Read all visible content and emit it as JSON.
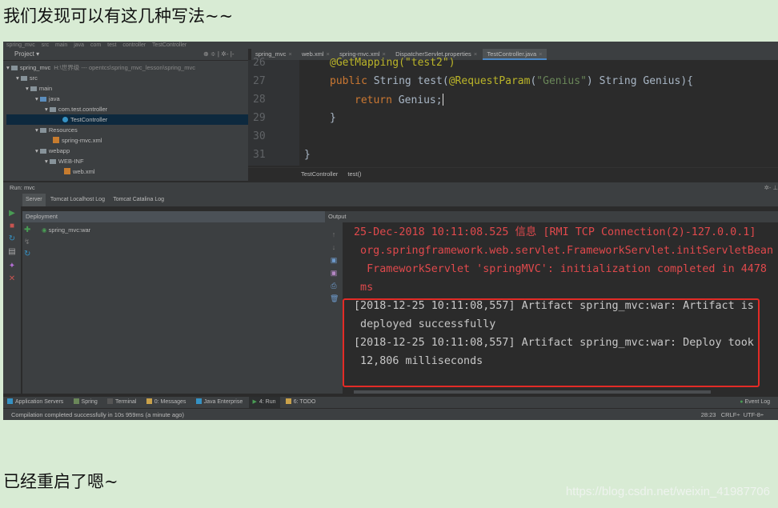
{
  "blog": {
    "heading": "我们发现可以有这几种写法~~",
    "footer_note": "已经重启了嗯~",
    "watermark": "https://blog.csdn.net/weixin_41987706"
  },
  "ide": {
    "navbar": [
      "spring_mvc",
      "src",
      "main",
      "java",
      "com",
      "test",
      "controller",
      "TestController"
    ],
    "project": {
      "title": "Project",
      "tools": "⊕ ≑ | ✲- |-",
      "tree": [
        {
          "label": "spring_mvc",
          "path": "H:\\世界级 --- opentcs\\spring_mvc_lesson\\spring_mvc",
          "icon": "folder-icon"
        },
        {
          "label": "src",
          "icon": "folder-icon"
        },
        {
          "label": "main",
          "icon": "folder-icon"
        },
        {
          "label": "java",
          "icon": "folder-icon"
        },
        {
          "label": "com.test.controller",
          "icon": "package-icon"
        },
        {
          "label": "TestController",
          "icon": "class-icon"
        },
        {
          "label": "Resources",
          "icon": "folder-icon"
        },
        {
          "label": "spring-mvc.xml",
          "icon": "xml-file-icon"
        },
        {
          "label": "webapp",
          "icon": "folder-icon"
        },
        {
          "label": "WEB-INF",
          "icon": "folder-icon"
        },
        {
          "label": "web.xml",
          "icon": "xml-file-icon"
        }
      ]
    },
    "editor_tabs": [
      "spring_mvc",
      "web.xml",
      "spring-mvc.xml",
      "DispatcherServlet.properties",
      "TestController.java"
    ],
    "code": {
      "line_numbers": [
        "26",
        "27",
        "28",
        "29",
        "30",
        "31"
      ],
      "line26": "@GetMapping(\"test2\")",
      "line27_kw": "public",
      "line27_rest": " String test(",
      "line27_ann": "@RequestParam",
      "line27_paren": "(",
      "line27_str": "\"Genius\"",
      "line27_end": ") String Genius){",
      "line28_kw": "return",
      "line28_rest": " Genius;",
      "line29": "}",
      "line31": "}"
    },
    "breadcrumb": [
      "TestController",
      "test()"
    ],
    "run": {
      "label": "Run:",
      "config": "mvc",
      "right_tools": "✲- ⊥",
      "tabs": [
        "Server",
        "Tomcat Localhost Log",
        "Tomcat Catalina Log"
      ],
      "deployment_header": "Deployment",
      "deployment_item": "spring_mvc:war",
      "output_header": "Output"
    },
    "console": {
      "red_lines": [
        "25-Dec-2018 10:11:08.525 信息 [RMI TCP Connection(2)-127.0.0.1]",
        " org.springframework.web.servlet.FrameworkServlet.initServletBean",
        "  FrameworkServlet 'springMVC': initialization completed in 4478",
        " ms"
      ],
      "grey_lines": [
        "[2018-12-25 10:11:08,557] Artifact spring_mvc:war: Artifact is",
        " deployed successfully",
        "[2018-12-25 10:11:08,557] Artifact spring_mvc:war: Deploy took",
        " 12,806 milliseconds"
      ]
    },
    "tool_windows": [
      "Application Servers",
      "Spring",
      "Terminal",
      "0: Messages",
      "Java Enterprise",
      "4: Run",
      "6: TODO"
    ],
    "event_log": "Event Log",
    "status": {
      "message": "Compilation completed successfully in 10s 959ms (a minute ago)",
      "position": "28:23",
      "line_sep": "CRLF÷",
      "encoding": "UTF-8÷"
    }
  }
}
